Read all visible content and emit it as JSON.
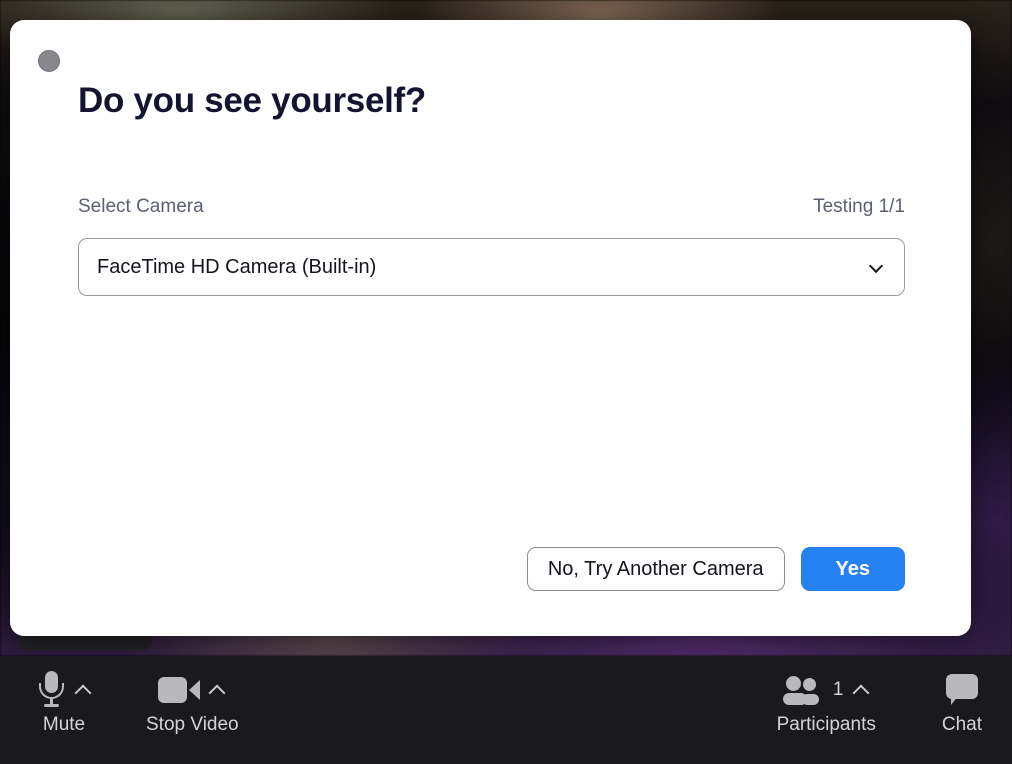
{
  "dialog": {
    "title": "Do you see yourself?",
    "close_icon": "close-circle-icon",
    "field_label": "Select Camera",
    "testing_status": "Testing 1/1",
    "camera_value": "FaceTime HD Camera (Built-in)",
    "camera_chevron_icon": "chevron-down-icon",
    "secondary_button": "No, Try Another Camera",
    "primary_button": "Yes",
    "primary_color": "#2681f2"
  },
  "toolbar": {
    "background_color": "#1a1a1c",
    "left_items": [
      {
        "label": "Mute",
        "icon": "microphone-icon",
        "caret_icon": "caret-up-icon"
      },
      {
        "label": "Stop Video",
        "icon": "video-camera-icon",
        "caret_icon": "caret-up-icon"
      }
    ],
    "right_items": [
      {
        "label": "Participants",
        "icon": "participants-icon",
        "count": "1",
        "caret_icon": "caret-up-icon"
      },
      {
        "label": "Chat",
        "icon": "chat-bubble-icon"
      }
    ]
  }
}
